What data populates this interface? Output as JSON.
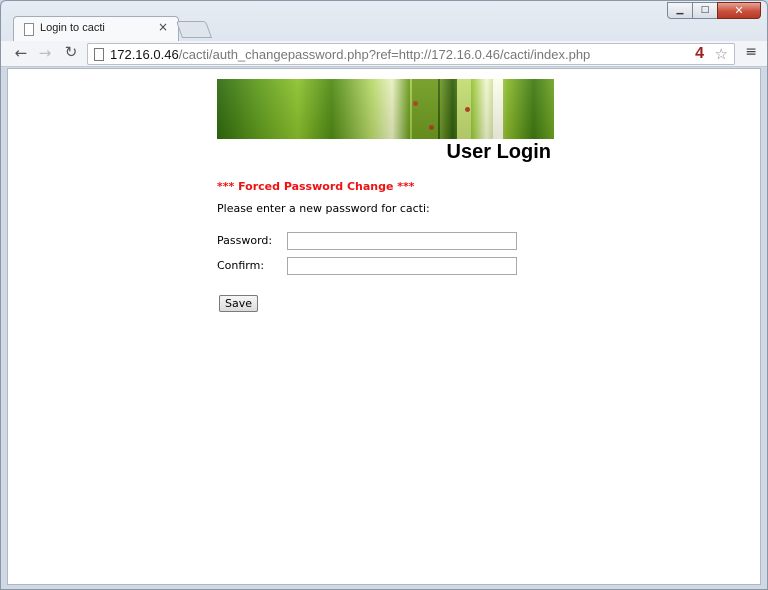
{
  "browser": {
    "tab_title": "Login to cacti",
    "tab_close": "×",
    "url_host": "172.16.0.46",
    "url_path": "/cacti/auth_changepassword.php?ref=http://172.16.0.46/cacti/index.php",
    "badge_count": "4",
    "star": "☆",
    "menu": "≡",
    "back": "←",
    "forward": "→",
    "reload": "↻",
    "window_buttons": {
      "minimize": "▁",
      "maximize": "□",
      "close": "✕"
    }
  },
  "page": {
    "title": "User Login",
    "warning": "*** Forced Password Change ***",
    "prompt": "Please enter a new password for cacti:",
    "password_label": "Password:",
    "password_value": "",
    "confirm_label": "Confirm:",
    "confirm_value": "",
    "save_label": "Save"
  }
}
